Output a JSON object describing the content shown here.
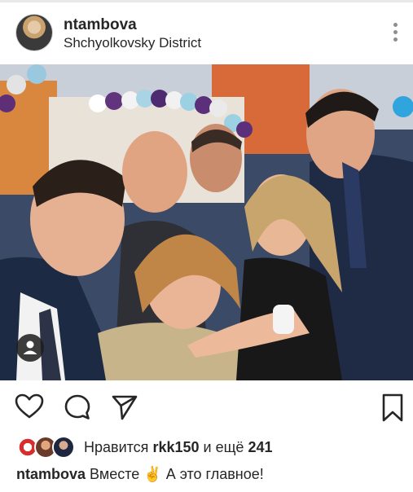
{
  "post": {
    "username": "ntambova",
    "location": "Shchyolkovsky District"
  },
  "likes": {
    "prefix": "Нравится",
    "user": "rkk150",
    "connector": "и ещё",
    "count": "241"
  },
  "caption": {
    "username": "ntambova",
    "text": "Вместе ✌️ А это главное!"
  },
  "icons": {
    "more": "more-vertical-icon",
    "like": "heart-icon",
    "comment": "comment-icon",
    "share": "send-icon",
    "save": "bookmark-icon",
    "photo_tag": "person-tag-icon"
  }
}
